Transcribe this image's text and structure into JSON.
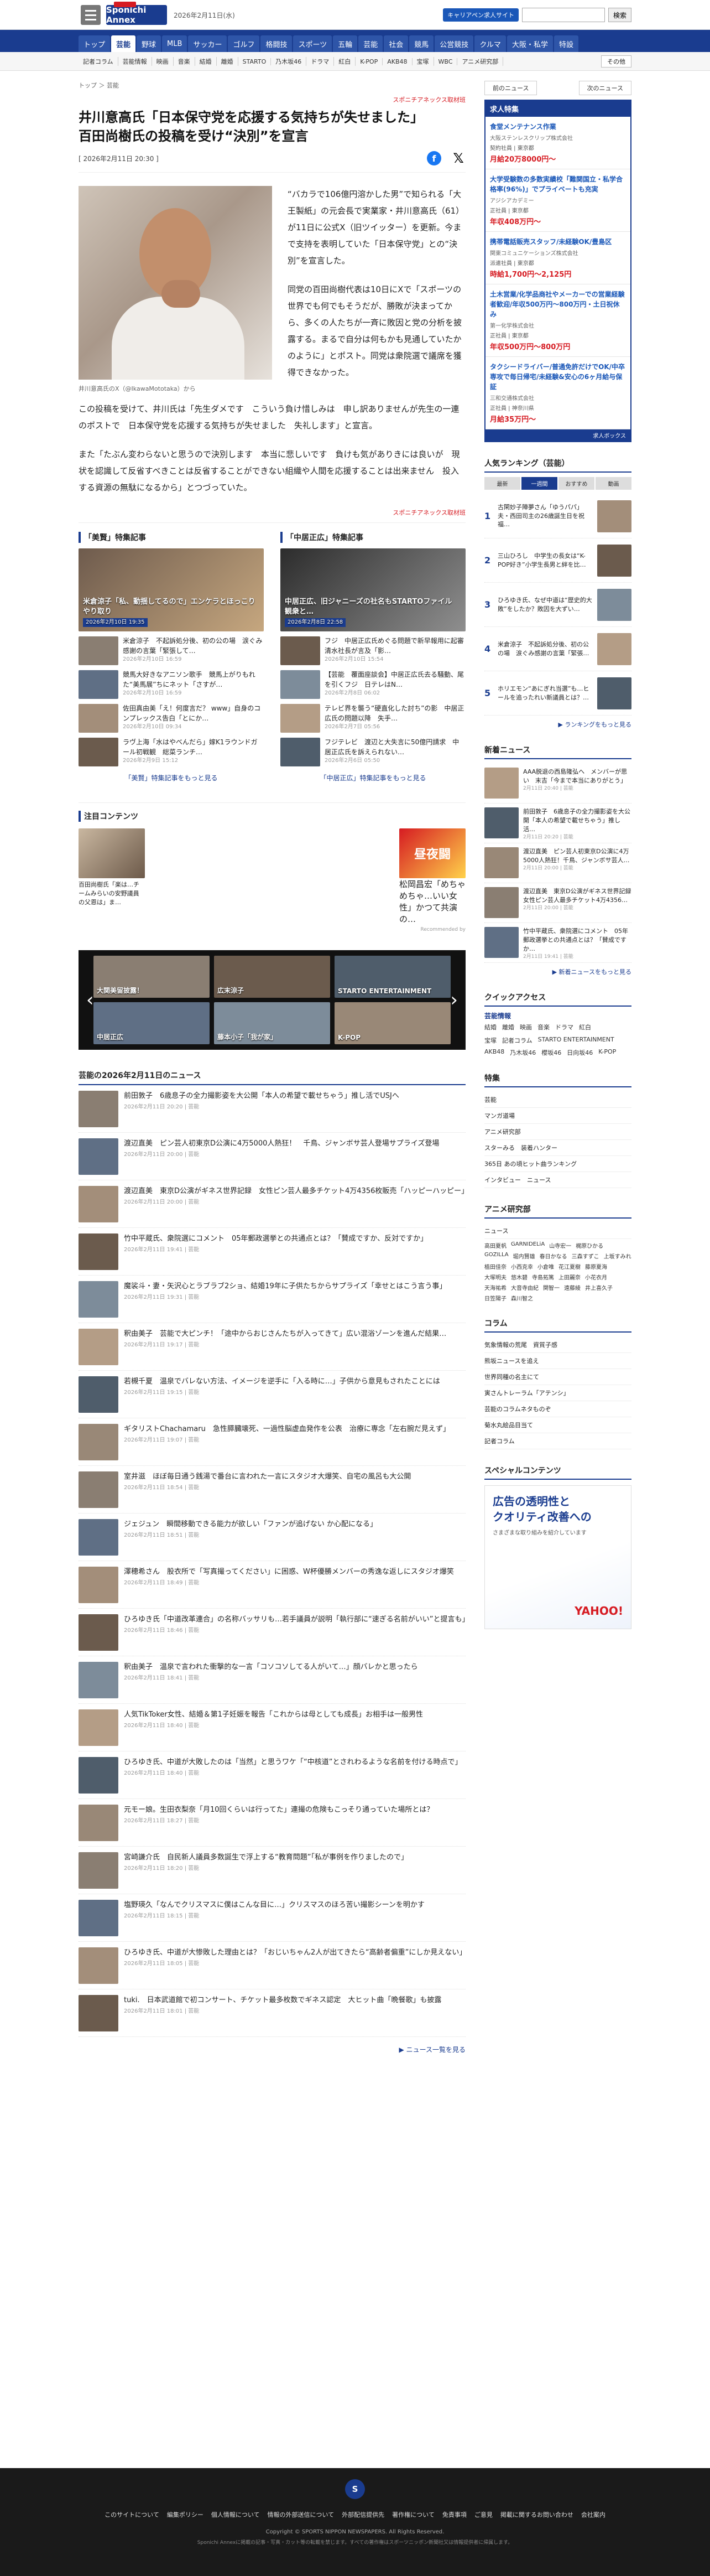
{
  "header": {
    "logo": "Sponichi Annex",
    "date": "2026年2月11日(水)",
    "cp_label": "キャリアペン求人サイト",
    "search_placeholder": "",
    "search_button": "検索"
  },
  "nav": [
    "トップ",
    "芸能",
    "野球",
    "MLB",
    "サッカー",
    "ゴルフ",
    "格闘技",
    "スポーツ",
    "五輪",
    "芸能",
    "社会",
    "競馬",
    "公営競技",
    "クルマ",
    "大阪・私学",
    "特設"
  ],
  "subnav": [
    "記者コラム",
    "芸能情報",
    "映画",
    "音楽",
    "結婚",
    "離婚",
    "STARTO",
    "乃木坂46",
    "ドラマ",
    "紅白",
    "K-POP",
    "AKB48",
    "宝塚",
    "WBC",
    "アニメ研究部"
  ],
  "subnav_more": "その他",
  "article": {
    "crumbs": "トップ ＞ 芸能",
    "source": "スポニチアネックス取材班",
    "title_line1": "井川意高氏「日本保守党を応援する気持ちが失せました」",
    "title_line2": "百田尚樹氏の投稿を受け“決別”を宣言",
    "date": "[ 2026年2月11日 20:30 ]",
    "caption": "井川意高氏のX（@IkawaMototaka）から",
    "p1": "“バカラで106億円溶かした男”で知られる「大王製紙」の元会長で実業家・井川意高氏（61）が11日に公式X（旧ツイッター）を更新。今まで支持を表明していた「日本保守党」との“決別”を宣言した。",
    "p2": "同党の百田尚樹代表は10日にXで「スポーツの世界でも何でもそうだが、勝敗が決まってから、多くの人たちが一斉に敗因と党の分析を披露する。まるで自分は何もかも見通していたかのように」とポスト。同党は衆院選で議席を獲得できなかった。",
    "p3": "この投稿を受けて、井川氏は「先生ダメです　こういう負け惜しみは　申し訳ありませんが先生の一連のポストで　日本保守党を応援する気持ちが失せました　失礼します」と宣言。",
    "p4": "また「たぶん変わらないと思うので決別します　本当に悲しいです　負けも気がありきには良いが　現状を認識して反省すべきことは反省することができない組織や人間を応援することは出来ません　投入する資源の無駄になるから」とつづっていた。"
  },
  "features": {
    "left": {
      "title": "「美賢」特集記事",
      "hero": "米倉涼子「私、動揺してるので」エンケラとほっこりやり取り",
      "hero_date": "2026年2月10日 19:35",
      "more": "「美賢」特集記事をもっと見る",
      "items": [
        {
          "t": "米倉涼子　不起訴処分後、初の公の場　涙ぐみ感謝の言葉「緊張して…",
          "d": "2026年2月10日 16:59"
        },
        {
          "t": "競馬大好きなアニソン歌手　競馬上がりもれた“美馬展”ちにネット「さすが…",
          "d": "2026年2月10日 16:59"
        },
        {
          "t": "佐田真由美「え！何度言だ？ www」自身のコンプレックス告白「とにか…",
          "d": "2026年2月10日 09:34"
        },
        {
          "t": "ラヴ上海「水はやべんだら」嫁K1ラウンドガール初戦観　総菜ランチ…",
          "d": "2026年2月9日 15:12"
        }
      ]
    },
    "right": {
      "title": "「中居正広」特集記事",
      "hero": "中居正広、旧ジャニーズの社名もSTARTOファイル　観衆と…",
      "hero_date": "2026年2月8日 22:58",
      "more": "「中居正広」特集記事をもっと見る",
      "items": [
        {
          "t": "フジ　中居正広氏めぐる問題で新早報用に起審　清水社長が言及「影…",
          "d": "2026年2月10日 15:54"
        },
        {
          "t": "【芸能　覆面座談会】中居正広氏去る騒動、尾を引くフジ　日テレはN…",
          "d": "2026年2月8日 06:02"
        },
        {
          "t": "テレビ界を襲う“硬直化した討ち”の影　中居正広氏の問題以降　失手…",
          "d": "2026年2月7日 05:56"
        },
        {
          "t": "フジテレビ　渡辺と大失言に50億円請求　中居正広氏を訴えられない…",
          "d": "2026年2月6日 05:50"
        }
      ]
    }
  },
  "chumoku": {
    "title": "注目コンテンツ",
    "left": "百田尚樹氏「楽は…チームみらいの安野議員の父恩は」ま…",
    "right": "松岡昌宏「めちゃめちゃ…いい女性」かつて共演の…",
    "ad_by": "Recommended by",
    "ad_label": "昼夜闘"
  },
  "carousel": [
    "大関美留披露！",
    "広末涼子",
    "STARTO ENTERTAINMENT",
    "中居正広",
    "藤本小子「我が家」",
    "K-POP"
  ],
  "newslist": {
    "title": "芸能の2026年2月11日のニュース",
    "more": "ニュース一覧を見る",
    "items": [
      {
        "t": "前田敦子　6歳息子の全力撮影姿を大公開「本人の希望で載せちゃう」推し活でUSJへ",
        "d": "2026年2月11日 20:20 | 芸能"
      },
      {
        "t": "渡辺直美　ピン芸人初東京D公演に4万5000人熱狂！　千鳥、ジャンボサ芸人登場サプライズ登場",
        "d": "2026年2月11日 20:00 | 芸能"
      },
      {
        "t": "渡辺直美　東京D公演がギネス世界記録　女性ピン芸人最多チケット4万4356枚販売「ハッピーハッピー」",
        "d": "2026年2月11日 20:00 | 芸能"
      },
      {
        "t": "竹中平蔵氏、衆院選にコメント　05年郵政選挙との共通点とは？「賛成ですか、反対ですか」",
        "d": "2026年2月11日 19:41 | 芸能"
      },
      {
        "t": "魔裟斗・妻・矢沢心とラブラブ2ショ、結婚19年に子供たちからサプライズ「幸せとはこう言う事」",
        "d": "2026年2月11日 19:31 | 芸能"
      },
      {
        "t": "釈由美子　芸能で大ピンチ！「途中からおじさんたちが入ってきて」広い混浴ゾーンを進んだ結果…",
        "d": "2026年2月11日 19:17 | 芸能"
      },
      {
        "t": "若槻千夏　温泉でバレない方法、イメージを逆手に「入る時に…」子供から意見もされたことには",
        "d": "2026年2月11日 19:15 | 芸能"
      },
      {
        "t": "ギタリストChachamaru　急性膵臓壊死、一過性脳虚血発作を公表　治療に専念「左右腕だ見えず」",
        "d": "2026年2月11日 19:07 | 芸能"
      },
      {
        "t": "室井滋　ほぼ毎日通う銭湯で番台に言われた一言にスタジオ大爆笑、自宅の風呂も大公開",
        "d": "2026年2月11日 18:54 | 芸能"
      },
      {
        "t": "ジェジュン　瞬間移動できる能力が欲しい「ファンが追げない か心配になる」",
        "d": "2026年2月11日 18:51 | 芸能"
      },
      {
        "t": "澤穂希さん　股衣所で「写真撮ってください」に困惑、W杯優勝メンバーの秀逸な返しにスタジオ爆笑",
        "d": "2026年2月11日 18:49 | 芸能"
      },
      {
        "t": "ひろゆき氏「中道改革連合」の名称バッサリも…若手議員が説明「執行部に“速ぎる名前がいい”と提言も」",
        "d": "2026年2月11日 18:46 | 芸能"
      },
      {
        "t": "釈由美子　温泉で言われた衝撃的な一言「コソコソしてる人がいて…」顔バレかと思ったら",
        "d": "2026年2月11日 18:41 | 芸能"
      },
      {
        "t": "人気TikToker女性、結婚＆第1子妊娠を報告「これからは母としても成長」お相手は一般男性",
        "d": "2026年2月11日 18:40 | 芸能"
      },
      {
        "t": "ひろゆき氏、中道が大敗したのは「当然」と思うワケ「“中核道”とされわるような名前を付ける時点で」",
        "d": "2026年2月11日 18:40 | 芸能"
      },
      {
        "t": "元モー娘。生田衣梨奈「月10回くらいは行ってた」連撮の危険もこっそり通っていた場所とは？",
        "d": "2026年2月11日 18:27 | 芸能"
      },
      {
        "t": "宮崎謙介氏　自民新人議員多数誕生で浮上する“教育問題”「私が事例を作りましたので」",
        "d": "2026年2月11日 18:20 | 芸能"
      },
      {
        "t": "塩野瑛久「なんでクリスマスに僕はこんな目に…」クリスマスのほろ苦い撮影シーンを明かす",
        "d": "2026年2月11日 18:15 | 芸能"
      },
      {
        "t": "ひろゆき氏、中道が大惨敗した理由とは？「おじいちゃん2人が出てきたら“高齢者偏重”にしか見えない」",
        "d": "2026年2月11日 18:05 | 芸能"
      },
      {
        "t": "tuki.　日本武道館で初コンサート、チケット最多枚数でギネス認定　大ヒット曲「晩餐歌」も披露",
        "d": "2026年2月11日 18:01 | 芸能"
      }
    ]
  },
  "right": {
    "prev": "前のニュース",
    "next": "次のニュース",
    "jobs_title": "求人特集",
    "jobs_foot": "求人ボックス",
    "jobs": [
      {
        "t": "食堂メンテナンス作業",
        "c": "大阪ステンレスクリップ株式会社",
        "m": "契約社員 | 東京都",
        "p": "月給20万8000円～"
      },
      {
        "t": "大学受験数の多数実績校「難関国立・私学合格率(96%)」でプライベートも充実",
        "c": "アジシアカデミー",
        "m": "正社員 | 東京都",
        "p": "年収408万円～"
      },
      {
        "t": "携帯電話販売スタッフ/未経験OK/豊島区",
        "c": "関東コミュニケーションズ株式会社",
        "m": "派遣社員 | 東京都",
        "p": "時給1,700円～2,125円"
      },
      {
        "t": "土木営業/化学品商社やメーカーでの営業経験者歓迎/年収500万円～800万円・土日祝休み",
        "c": "第一化学株式会社",
        "m": "正社員 | 東京都",
        "p": "年収500万円～800万円"
      },
      {
        "t": "タクシードライバー/普通免許だけでOK/中卒専攻で毎日帰宅/未経験&安心の6ヶ月給与保証",
        "c": "三和交通株式会社",
        "m": "正社員 | 神奈川県",
        "p": "月給35万円～"
      }
    ],
    "rank_title": "人気ランキング（芸能）",
    "rank_tabs": [
      "最新",
      "一週間",
      "おすすめ",
      "動画"
    ],
    "rank": [
      {
        "n": "1",
        "t": "古閑妙子陣夢さん「ゆうパパ」夫・西田司主の26歳誕生日を祝福…"
      },
      {
        "n": "2",
        "t": "三山ひろし　中学生の長女は“K-POP好き”小学生長男と絆を比…"
      },
      {
        "n": "3",
        "t": "ひろゆき氏、なぜ中道は“歴史的大敗”をしたか？敗因を大ずい…"
      },
      {
        "n": "4",
        "t": "米倉涼子　不起訴処分後、初の公の場　涙ぐみ感謝の言葉「緊張…"
      },
      {
        "n": "5",
        "t": "ホリエモン“あにぎれ当選”も…ヒールを追ったれい新議員とは？…"
      }
    ],
    "rank_more": "ランキングをもっと見る",
    "new_title": "新着ニュース",
    "new": [
      {
        "t": "AAA脱退の西島隆弘へ　メンバーが思い　末吉「今まで本当にありがとう」",
        "d": "2月11日 20:40 | 芸能"
      },
      {
        "t": "前田敦子　6歳息子の全力撮影姿を大公開「本人の希望で載せちゃう」推し活…",
        "d": "2月11日 20:20 | 芸能"
      },
      {
        "t": "渡辺直美　ピン芸人初東京D公演に4万5000人熱狂！千鳥、ジャンボサ芸人…",
        "d": "2月11日 20:00 | 芸能"
      },
      {
        "t": "渡辺直美　東京D公演がギネス世界記録　女性ピン芸人最多チケット4万4356…",
        "d": "2月11日 20:00 | 芸能"
      },
      {
        "t": "竹中平蔵氏、衆院選にコメント　05年郵政選挙との共通点とは？「賛成ですか…",
        "d": "2月11日 19:41 | 芸能"
      }
    ],
    "new_more": "新着ニュースをもっと見る",
    "qa_title": "クイックアクセス",
    "qa_h1": "芸能情報",
    "qa1": [
      "結婚",
      "離婚",
      "映画",
      "音楽",
      "ドラマ",
      "紅白"
    ],
    "qa2": [
      "宝塚",
      "記者コラム",
      "STARTO ENTERTAINMENT",
      "AKB48",
      "乃木坂46",
      "櫻坂46",
      "日向坂46",
      "K-POP"
    ],
    "toku_title": "特集",
    "toku": [
      "芸能",
      "マンガ道場",
      "アニメ研究部",
      "スターみる　装着ハンター",
      "365日 あの頃ヒット曲ランキング",
      "インタビュー　ニュース"
    ],
    "anime_title": "アニメ研究部",
    "anime_h": "ニュース",
    "anime": [
      "高田夏帆",
      "GARNIDELiA",
      "山寺宏一",
      "梶原ひかる",
      "GOZILLA",
      "堀内賢雄",
      "春日かなる",
      "三森すずこ",
      "上坂すみれ",
      "植田佳奈",
      "小西克幸",
      "小倉唯",
      "花江夏樹",
      "藤原夏海",
      "大塚明夫",
      "悠木碧",
      "寺島拓篤",
      "上田麗奈",
      "小花衣月",
      "天海祐希",
      "大音寺由紀",
      "関智一",
      "遠藤綾",
      "井上喜久子",
      "日笠陽子",
      "森川智之"
    ],
    "col_title": "コラム",
    "col": [
      "気象情報の荒尾　資質子感",
      "熊坂ニュースを追え",
      "世界同種の名主にて",
      "寅さんトレーラム「アテンシ」",
      "芸能のコラムネタものぞ",
      "菊水丸絵品目当て",
      "記者コラム"
    ],
    "sp_title": "スペシャルコンテンツ",
    "ad_line1": "広告の透明性と",
    "ad_line2": "クオリティ改善への",
    "ad_sub": "さまざまな取り組みを紹介しています",
    "ad_brand": "YAHOO!"
  },
  "footer": {
    "links": [
      "このサイトについて",
      "編集ポリシー",
      "個人情報について",
      "情報の外部送信について",
      "外部配信提供先",
      "著作権について",
      "免責事項",
      "ご意見",
      "掲載に関するお問い合わせ",
      "会社案内"
    ],
    "copy": "Copyright © SPORTS NIPPON NEWSPAPERS. All Rights Reserved.",
    "note": "Sponichi Annexに掲載の記事・写真・カット等の転載を禁じます。すべての著作権はスポーツニッポン新聞社又は情報提供者に帰属します。"
  }
}
